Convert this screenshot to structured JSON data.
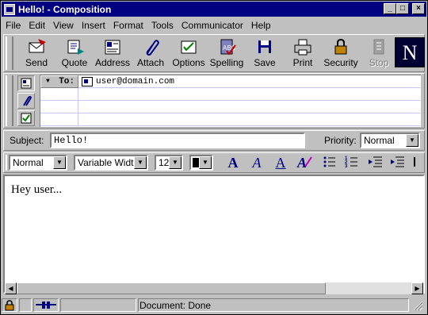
{
  "window": {
    "title": "Hello! - Composition",
    "minimize": "_",
    "maximize": "□",
    "close": "×"
  },
  "menu": {
    "items": [
      "File",
      "Edit",
      "View",
      "Insert",
      "Format",
      "Tools",
      "Communicator",
      "Help"
    ]
  },
  "toolbar": {
    "buttons": [
      {
        "label": "Send",
        "icon": "send-icon"
      },
      {
        "label": "Quote",
        "icon": "quote-icon"
      },
      {
        "label": "Address",
        "icon": "address-icon"
      },
      {
        "label": "Attach",
        "icon": "attach-icon"
      },
      {
        "label": "Options",
        "icon": "options-icon"
      },
      {
        "label": "Spelling",
        "icon": "spelling-icon"
      },
      {
        "label": "Save",
        "icon": "save-icon"
      },
      {
        "label": "Print",
        "icon": "print-icon"
      },
      {
        "label": "Security",
        "icon": "lock-icon"
      },
      {
        "label": "Stop",
        "icon": "stop-icon",
        "disabled": true
      }
    ],
    "logo": "N"
  },
  "address": {
    "to_label": "To:",
    "to_value": "user@domain.com"
  },
  "subject": {
    "label": "Subject:",
    "value": "Hello!"
  },
  "priority": {
    "label": "Priority:",
    "value": "Normal"
  },
  "format": {
    "paragraph": "Normal",
    "font": "Variable Width",
    "size": "12",
    "color": "#000000",
    "big_a": "A",
    "italic_a": "A",
    "underline_a": "A"
  },
  "body": {
    "text": "Hey user..."
  },
  "status": {
    "text": "Document: Done"
  }
}
